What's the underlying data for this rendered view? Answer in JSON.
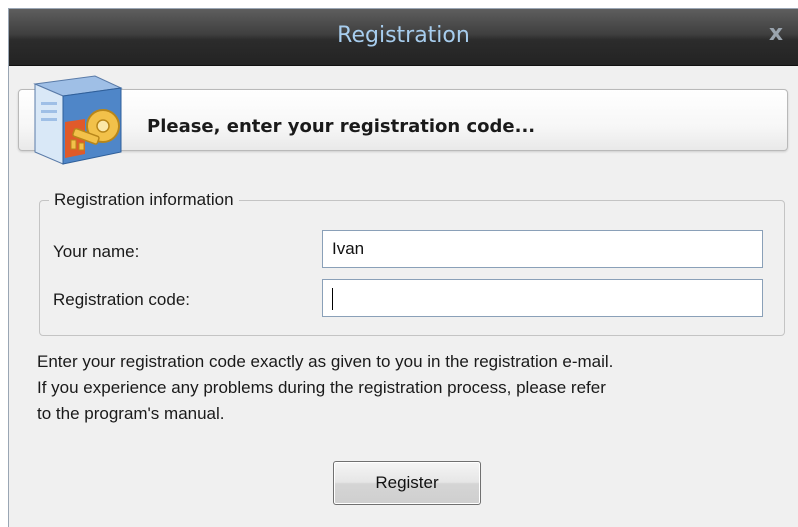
{
  "window": {
    "title": "Registration",
    "close_symbol": "x"
  },
  "banner": {
    "text": "Please, enter your registration code...",
    "icon": "registration-key-icon"
  },
  "registration_info": {
    "legend": "Registration information",
    "name_label": "Your name:",
    "name_value": "Ivan",
    "code_label": "Registration code:",
    "code_value": ""
  },
  "help": {
    "line1": "Enter your registration code exactly as given to you in the registration e-mail.",
    "line2": "If you experience any problems during the registration process, please refer",
    "line3": "to the program's manual."
  },
  "buttons": {
    "register_label": "Register"
  },
  "colors": {
    "title_text": "#a7cdee",
    "titlebar_dark": "#2c2c2c",
    "dialog_bg": "#f0f0f0",
    "field_border": "#8aa0b8"
  }
}
